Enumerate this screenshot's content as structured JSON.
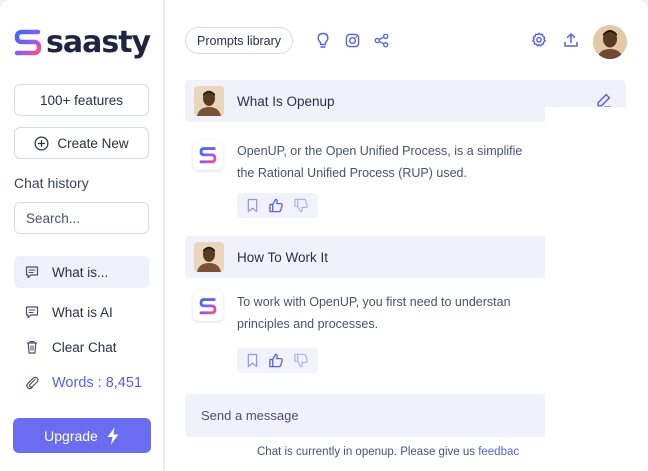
{
  "brand": {
    "name": "saasty"
  },
  "sidebar": {
    "features_label": "100+ features",
    "create_label": "Create New",
    "history_title": "Chat history",
    "search_placeholder": "Search...",
    "items": [
      {
        "label": "What is...",
        "icon": "chat-bubble-icon"
      },
      {
        "label": "What is AI",
        "icon": "chat-bubble-icon"
      },
      {
        "label": "Clear Chat",
        "icon": "trash-icon"
      },
      {
        "label": "Words : 8,451",
        "icon": "paperclip-icon"
      }
    ],
    "upgrade_label": "Upgrade"
  },
  "header": {
    "prompts_label": "Prompts library",
    "icons": [
      "lightbulb-icon",
      "instagram-icon",
      "share-icon",
      "settings-icon",
      "upload-icon",
      "user-avatar"
    ]
  },
  "chat": [
    {
      "question": "What Is Openup",
      "answer_lines": [
        "OpenUP, or the Open Unified Process, is a simplifie",
        "the Rational Unified Process (RUP) used."
      ]
    },
    {
      "question": "How To Work It",
      "answer_lines": [
        "To work with OpenUP, you first need to understan",
        "principles and processes."
      ]
    }
  ],
  "composer": {
    "placeholder": "Send a message",
    "note": "Chat is currently in openup. Please give us ",
    "note_link": "feedbac"
  },
  "colors": {
    "accent": "#6b6df0",
    "link": "#5560e8",
    "highlight": "#f0f1fb"
  }
}
